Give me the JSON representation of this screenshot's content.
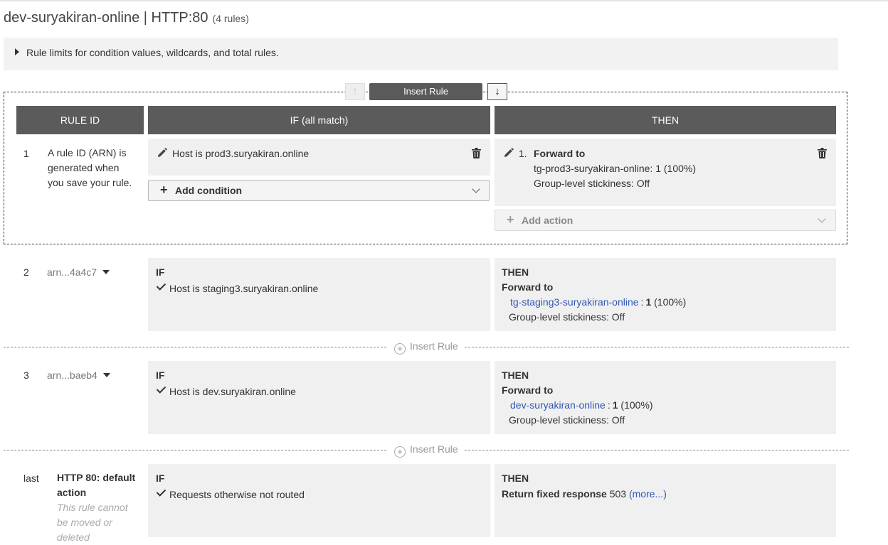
{
  "header": {
    "title": "dev-suryakiran-online | HTTP:80",
    "rule_count": "(4 rules)"
  },
  "limits": {
    "label": "Rule limits for condition values, wildcards, and total rules."
  },
  "toolbar": {
    "move_up": "↑",
    "insert_rule": "Insert Rule",
    "move_down": "↓"
  },
  "columns": {
    "rule_id": "RULE ID",
    "if": "IF (all match)",
    "then": "THEN"
  },
  "new_rule": {
    "number": "1",
    "id_note_line1": "A rule ID (ARN) is",
    "id_note_line2": "generated when",
    "id_note_line3": "you save your rule.",
    "condition_label": "Host is",
    "condition_value": "prod3.suryakiran.online",
    "add_condition": "Add condition",
    "action_index": "1.",
    "action_title": "Forward to",
    "action_target": "tg-prod3-suryakiran-online: 1 (100%)",
    "action_stickiness": "Group-level stickiness: Off",
    "add_action": "Add action"
  },
  "rules": [
    {
      "number": "2",
      "arn": "arn...4a4c7",
      "if_label": "IF",
      "condition": "Host is staging3.suryakiran.online",
      "then_label": "THEN",
      "action": "Forward to",
      "target": "tg-staging3-suryakiran-online",
      "weight_sep": ":",
      "weight": "1",
      "weight_pct": "(100%)",
      "stickiness": "Group-level stickiness: Off"
    },
    {
      "number": "3",
      "arn": "arn...baeb4",
      "if_label": "IF",
      "condition": "Host is dev.suryakiran.online",
      "then_label": "THEN",
      "action": "Forward to",
      "target": "dev-suryakiran-online",
      "weight_sep": ":",
      "weight": "1",
      "weight_pct": "(100%)",
      "stickiness": "Group-level stickiness: Off"
    }
  ],
  "insert_rule_link": "Insert Rule",
  "default_rule": {
    "number": "last",
    "name_line1": "HTTP 80: default",
    "name_line2": "action",
    "note_line1": "This rule cannot",
    "note_line2": "be moved or",
    "note_line3": "deleted",
    "if_label": "IF",
    "condition": "Requests otherwise not routed",
    "then_label": "THEN",
    "action": "Return fixed response",
    "status_code": "503",
    "more_link": "(more...)"
  }
}
